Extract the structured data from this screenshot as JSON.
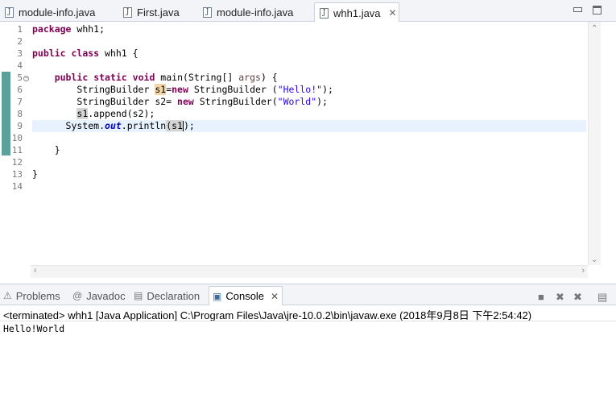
{
  "editor_tabs": [
    {
      "label": "module-info.java",
      "active": false
    },
    {
      "label": "First.java",
      "active": false
    },
    {
      "label": "module-info.java",
      "active": false
    },
    {
      "label": "whh1.java",
      "active": true
    }
  ],
  "tab_close_glyph": "✕",
  "file_icon": "java-file-icon",
  "line_numbers": [
    "1",
    "2",
    "3",
    "4",
    "5",
    "6",
    "7",
    "8",
    "9",
    "10",
    "11",
    "12",
    "13",
    "14"
  ],
  "code": {
    "l1_kw": "package",
    "l1_rest": " whh1;",
    "l3_kw1": "public",
    "l3_kw2": "class",
    "l3_rest": " whh1 {",
    "l5_indent": "    ",
    "l5_kw1": "public",
    "l5_kw2": "static",
    "l5_kw3": "void",
    "l5_mid": " main(String[] ",
    "l5_param": "args",
    "l5_end": ") {",
    "l6_pre": "        StringBuilder ",
    "l6_var": "s1",
    "l6_eq": "=",
    "l6_kw": "new",
    "l6_mid": " StringBuilder (",
    "l6_str": "\"Hello!\"",
    "l6_end": ");",
    "l7_pre": "        StringBuilder s2= ",
    "l7_kw": "new",
    "l7_mid": " StringBuilder(",
    "l7_str": "\"World\"",
    "l7_end": ");",
    "l8_pre": "        ",
    "l8_var": "s1",
    "l8_rest": ".append(s2);",
    "l9_pre": "      System.",
    "l9_fld": "out",
    "l9_mid": ".println",
    "l9_paren": "(",
    "l9_var": "s1",
    "l9_end": ");",
    "l11": "    }",
    "l13": "}"
  },
  "panel_tabs": [
    {
      "label": "Problems",
      "icon": "problems-icon",
      "glyph": "⚠"
    },
    {
      "label": "Javadoc",
      "icon": "javadoc-icon",
      "glyph": "@"
    },
    {
      "label": "Declaration",
      "icon": "declaration-icon",
      "glyph": "▤"
    },
    {
      "label": "Console",
      "icon": "console-icon",
      "glyph": "▣",
      "active": true
    }
  ],
  "console": {
    "status": "<terminated> whh1 [Java Application] C:\\Program Files\\Java\\jre-10.0.2\\bin\\javaw.exe (2018年9月8日 下午2:54:42)",
    "output": "Hello!World"
  },
  "colors": {
    "keyword": "#7f0055",
    "string": "#2a00ff",
    "field": "#0000c0",
    "change_marker": "#5ba19b",
    "current_line": "#e8f2fe"
  }
}
